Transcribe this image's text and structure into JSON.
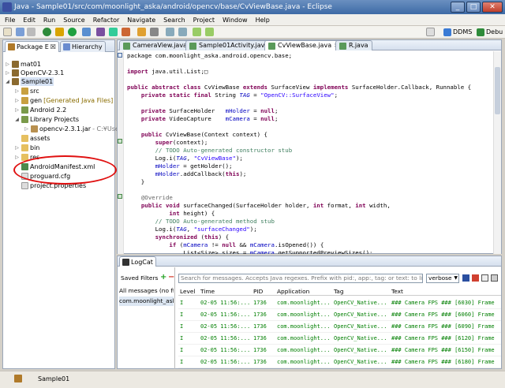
{
  "window": {
    "title": "Java - Sample01/src/com/moonlight_aska/android/opencv/base/CvViewBase.java - Eclipse",
    "buttons": [
      "_",
      "□",
      "✕"
    ]
  },
  "menu": [
    "File",
    "Edit",
    "Run",
    "Source",
    "Refactor",
    "Navigate",
    "Search",
    "Project",
    "Window",
    "Help"
  ],
  "perspectives": [
    {
      "label": "DDMS"
    },
    {
      "label": "Debu"
    }
  ],
  "left_tabs": [
    {
      "label": "Package E",
      "close": "☒"
    },
    {
      "label": "Hierarchy"
    }
  ],
  "tree": [
    {
      "label": "mat01",
      "icon": "project-icon",
      "twisty": "▷"
    },
    {
      "label": "OpenCV-2.3.1",
      "icon": "project-icon",
      "twisty": "▷"
    },
    {
      "label": "Sample01",
      "icon": "project-icon",
      "twisty": "◢"
    },
    {
      "label": "src",
      "icon": "src-folder-icon",
      "twisty": "▷"
    },
    {
      "label": "gen",
      "extra": "[Generated Java Files]",
      "icon": "src-folder-icon",
      "twisty": "▷"
    },
    {
      "label": "Android 2.2",
      "icon": "library-icon",
      "twisty": "▷"
    },
    {
      "label": "Library Projects",
      "icon": "library-icon",
      "twisty": "◢"
    },
    {
      "label": "opencv-2.3.1.jar",
      "extra": "- C:¥Users",
      "icon": "jar-icon",
      "twisty": "▷"
    },
    {
      "label": "assets",
      "icon": "folder-icon",
      "twisty": ""
    },
    {
      "label": "bin",
      "icon": "folder-icon",
      "twisty": "▷"
    },
    {
      "label": "res",
      "icon": "folder-icon",
      "twisty": "▷"
    },
    {
      "label": "AndroidManifest.xml",
      "icon": "xml-file-icon",
      "twisty": ""
    },
    {
      "label": "proguard.cfg",
      "icon": "file-icon",
      "twisty": ""
    },
    {
      "label": "project.properties",
      "icon": "file-icon",
      "twisty": ""
    }
  ],
  "editor_tabs": [
    {
      "label": "CameraView.java"
    },
    {
      "label": "Sample01Activity.java"
    },
    {
      "label": "CvViewBase.java",
      "close": "✕"
    },
    {
      "label": "R.java"
    }
  ],
  "code": [
    [
      [
        "package com.moonlight_aska.android.opencv.base;",
        ""
      ]
    ],
    [
      [
        "",
        ""
      ]
    ],
    [
      [
        "import",
        "kw"
      ],
      [
        " java.util.List;",
        ""
      ],
      [
        "□",
        ""
      ]
    ],
    [
      [
        "",
        ""
      ]
    ],
    [
      [
        "public abstract class",
        "kw"
      ],
      [
        " CvViewBase ",
        ""
      ],
      [
        "extends",
        "kw"
      ],
      [
        " SurfaceView ",
        ""
      ],
      [
        "implements",
        "kw"
      ],
      [
        " SurfaceHolder.Callback, Runnable {",
        ""
      ]
    ],
    [
      [
        "    ",
        ""
      ],
      [
        "private static final",
        "kw"
      ],
      [
        " String ",
        ""
      ],
      [
        "TAG",
        "fld"
      ],
      [
        " = ",
        ""
      ],
      [
        "\"OpenCV::SurfaceView\"",
        "str"
      ],
      [
        ";",
        ""
      ]
    ],
    [
      [
        "",
        ""
      ]
    ],
    [
      [
        "    ",
        ""
      ],
      [
        "private",
        "kw"
      ],
      [
        " SurfaceHolder   ",
        ""
      ],
      [
        "mHolder",
        "fld2"
      ],
      [
        " = ",
        ""
      ],
      [
        "null",
        "kw"
      ],
      [
        ";",
        ""
      ]
    ],
    [
      [
        "    ",
        ""
      ],
      [
        "private",
        "kw"
      ],
      [
        " VideoCapture    ",
        ""
      ],
      [
        "mCamera",
        "fld2"
      ],
      [
        " = ",
        ""
      ],
      [
        "null",
        "kw"
      ],
      [
        ";",
        ""
      ]
    ],
    [
      [
        "",
        ""
      ]
    ],
    [
      [
        "    ",
        ""
      ],
      [
        "public",
        "kw"
      ],
      [
        " CvViewBase(Context context) {",
        ""
      ]
    ],
    [
      [
        "        ",
        ""
      ],
      [
        "super",
        "kw"
      ],
      [
        "(context);",
        ""
      ]
    ],
    [
      [
        "        ",
        ""
      ],
      [
        "// TODO Auto-generated constructor stub",
        "cm"
      ]
    ],
    [
      [
        "        Log.i(",
        ""
      ],
      [
        "TAG",
        "fld"
      ],
      [
        ", ",
        ""
      ],
      [
        "\"CvViewBase\"",
        "str"
      ],
      [
        ");",
        ""
      ]
    ],
    [
      [
        "        ",
        ""
      ],
      [
        "mHolder",
        "fld2"
      ],
      [
        " = getHolder();",
        ""
      ]
    ],
    [
      [
        "        ",
        ""
      ],
      [
        "mHolder",
        "fld2"
      ],
      [
        ".addCallback(",
        ""
      ],
      [
        "this",
        "kw"
      ],
      [
        ");",
        ""
      ]
    ],
    [
      [
        "    }",
        ""
      ]
    ],
    [
      [
        "",
        ""
      ]
    ],
    [
      [
        "    ",
        ""
      ],
      [
        "@Override",
        "an"
      ]
    ],
    [
      [
        "    ",
        ""
      ],
      [
        "public void",
        "kw"
      ],
      [
        " surfaceChanged(SurfaceHolder holder, ",
        ""
      ],
      [
        "int",
        "kw"
      ],
      [
        " format, ",
        ""
      ],
      [
        "int",
        "kw"
      ],
      [
        " width,",
        ""
      ]
    ],
    [
      [
        "            ",
        ""
      ],
      [
        "int",
        "kw"
      ],
      [
        " height) {",
        ""
      ]
    ],
    [
      [
        "        ",
        ""
      ],
      [
        "// TODO Auto-generated method stub",
        "cm"
      ]
    ],
    [
      [
        "        Log.i(",
        ""
      ],
      [
        "TAG",
        "fld"
      ],
      [
        ", ",
        ""
      ],
      [
        "\"surfaceChanged\"",
        "str"
      ],
      [
        ");",
        ""
      ]
    ],
    [
      [
        "        ",
        ""
      ],
      [
        "synchronized",
        "kw"
      ],
      [
        " (",
        ""
      ],
      [
        "this",
        "kw"
      ],
      [
        ") {",
        ""
      ]
    ],
    [
      [
        "            ",
        ""
      ],
      [
        "if",
        "kw"
      ],
      [
        " (",
        ""
      ],
      [
        "mCamera",
        "fld2"
      ],
      [
        " != ",
        ""
      ],
      [
        "null",
        "kw"
      ],
      [
        " && ",
        ""
      ],
      [
        "mCamera",
        "fld2"
      ],
      [
        ".isOpened()) {",
        ""
      ]
    ],
    [
      [
        "                List<Size> sizes = ",
        ""
      ],
      [
        "mCamera",
        "fld2"
      ],
      [
        ".getSupportedPreviewSizes();",
        ""
      ]
    ],
    [
      [
        "                ",
        ""
      ],
      [
        "int",
        "kw"
      ],
      [
        " mFrameWidth = width;",
        ""
      ]
    ]
  ],
  "logcat": {
    "title": "LogCat",
    "saved_filters": "Saved Filters",
    "filter_items": [
      "All messages (no fil",
      "com.moonlight_aska"
    ],
    "search_placeholder": "Search for messages. Accepts Java regexes. Prefix with pid:, app:, tag: or text: to limit scope.",
    "verbosity": "verbose",
    "columns": [
      "Level",
      "Time",
      "PID",
      "Application",
      "Tag",
      "Text"
    ],
    "rows": [
      [
        "I",
        "02-05 11:56:...",
        "1736",
        "com.moonlight...",
        "OpenCV_Native...",
        "### Camera FPS ### [6030] Frame"
      ],
      [
        "I",
        "02-05 11:56:...",
        "1736",
        "com.moonlight...",
        "OpenCV_Native...",
        "### Camera FPS ### [6060] Frame"
      ],
      [
        "I",
        "02-05 11:56:...",
        "1736",
        "com.moonlight...",
        "OpenCV_Native...",
        "### Camera FPS ### [6090] Frame"
      ],
      [
        "I",
        "02-05 11:56:...",
        "1736",
        "com.moonlight...",
        "OpenCV_Native...",
        "### Camera FPS ### [6120] Frame"
      ],
      [
        "I",
        "02-05 11:56:...",
        "1736",
        "com.moonlight...",
        "OpenCV_Native...",
        "### Camera FPS ### [6150] Frame"
      ],
      [
        "I",
        "02-05 11:56:...",
        "1736",
        "com.moonlight...",
        "OpenCV_Native...",
        "### Camera FPS ### [6180] Frame"
      ]
    ]
  },
  "status": {
    "text": "Sample01"
  }
}
